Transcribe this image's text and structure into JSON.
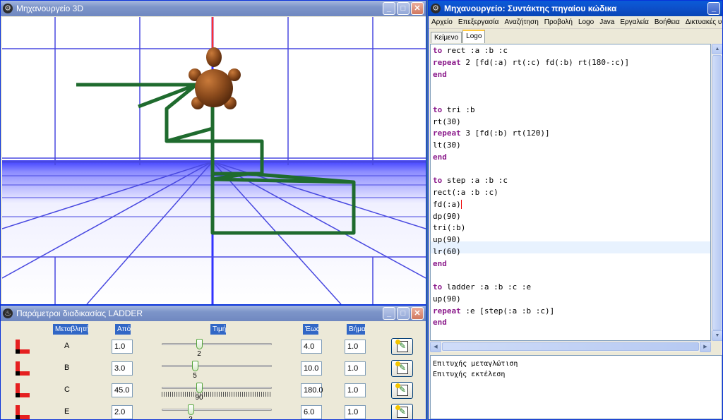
{
  "window3d": {
    "title": "Μηχανουργείο 3D"
  },
  "params": {
    "title": "Παράμετροι διαδικασίας LADDER",
    "headers": {
      "variable": "Μεταβλητή",
      "from": "Από",
      "value": "Τιμή",
      "to": "Έως",
      "step": "Βήμα"
    },
    "rows": [
      {
        "name": "A",
        "from": "1.0",
        "value": "2",
        "to": "4.0",
        "step": "1.0",
        "level": 0.33
      },
      {
        "name": "B",
        "from": "3.0",
        "value": "5",
        "to": "10.0",
        "step": "1.0",
        "level": 0.29
      },
      {
        "name": "C",
        "from": "45.0",
        "value": "90",
        "to": "180.0",
        "step": "1.0",
        "level": 0.33
      },
      {
        "name": "E",
        "from": "2.0",
        "value": "3",
        "to": "6.0",
        "step": "1.0",
        "level": 0.25
      }
    ]
  },
  "editor": {
    "title": "Μηχανουργείο: Συντάκτης πηγαίου κώδικα",
    "menu": [
      "Αρχείο",
      "Επεξεργασία",
      "Αναζήτηση",
      "Προβολή",
      "Logo",
      "Java",
      "Εργαλεία",
      "Βοήθεια",
      "Δικτυακές υπηρεσίες"
    ],
    "tabs": [
      "Κείμενο",
      "Logo"
    ],
    "active_tab": "Logo",
    "code": [
      "to rect :a :b :c",
      "repeat 2 [fd(:a) rt(:c) fd(:b) rt(180-:c)]",
      "end",
      "",
      "",
      "to tri :b",
      "rt(30)",
      "repeat 3 [fd(:b) rt(120)]",
      "lt(30)",
      "end",
      "",
      "to step :a :b :c",
      "rect(:a :b :c)",
      "fd(:a)",
      "dp(90)",
      "tri(:b)",
      "up(90)",
      "lr(60)",
      "end",
      "",
      "to ladder :a :b :c :e",
      "up(90)",
      "repeat :e [step(:a :b :c)]",
      "end"
    ],
    "console": [
      "Επιτυχής μεταγλώτιση",
      "Επιτυχής εκτέλεση"
    ]
  },
  "colors": {
    "title_active": "#0a5bd8",
    "title_inactive": "#7d95c9",
    "keyword": "#8b1a8b",
    "turtle_path": "#1f6b2e",
    "turtle_body": "#8a4a1c"
  }
}
